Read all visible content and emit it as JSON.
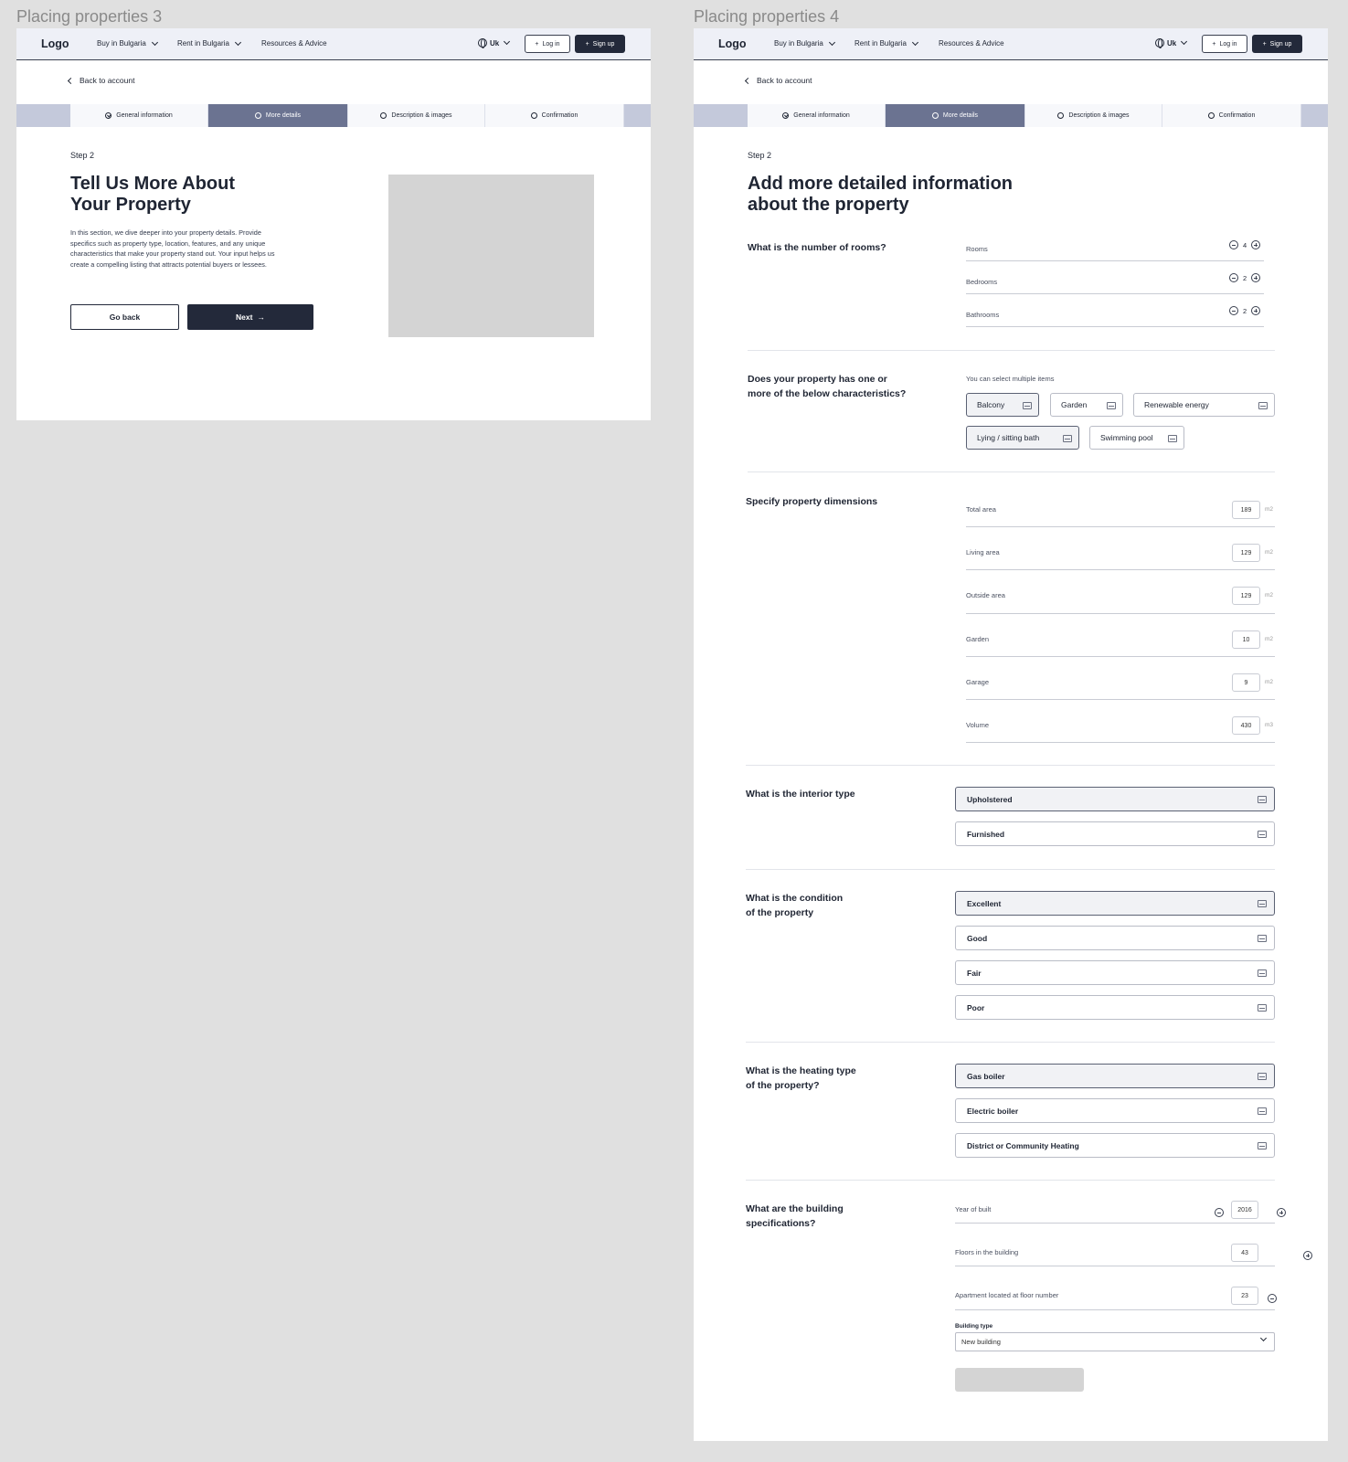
{
  "frames": {
    "left_label": "Placing properties 3",
    "right_label": "Placing properties 4"
  },
  "nav": {
    "logo": "Logo",
    "buy": "Buy in Bulgaria",
    "rent": "Rent in Bulgaria",
    "resources": "Resources & Advice",
    "lang": "Uk",
    "login": "Log in",
    "signup": "Sign up"
  },
  "back": "Back to account",
  "steps": [
    "General information",
    "More details",
    "Description & images",
    "Confirmation"
  ],
  "active_step": 1,
  "step_label": "Step 2",
  "intro": {
    "title_line1": "Tell Us More About",
    "title_line2": "Your Property",
    "para1": "In this section, we dive deeper into your property details. Provide",
    "para2": "specifics such as property type, location, features, and any unique",
    "para3": "characteristics that make your property stand out. Your input helps us",
    "para4": "create a compelling listing that attracts potential buyers or lessees.",
    "go_back": "Go back",
    "next": "Next"
  },
  "form": {
    "title_line1": "Add more detailed information",
    "title_line2": "about the property",
    "rooms_q": "What is the number of rooms?",
    "rooms": [
      {
        "label": "Rooms",
        "value": "4"
      },
      {
        "label": "Bedrooms",
        "value": "2"
      },
      {
        "label": "Bathrooms",
        "value": "2"
      }
    ],
    "char_q1": "Does your property has one or",
    "char_q2": "more of the below characteristics?",
    "char_hint": "You can select multiple items",
    "characteristics": [
      "Balcony",
      "Garden",
      "Renewable energy",
      "Lying / sitting bath",
      "Swimming pool"
    ],
    "characteristics_selected": [
      "Balcony",
      "Lying / sitting bath"
    ],
    "dim_q": "Specify property dimensions",
    "dimensions": [
      {
        "label": "Total area",
        "value": "189",
        "unit": "m2"
      },
      {
        "label": "Living area",
        "value": "129",
        "unit": "m2"
      },
      {
        "label": "Outside area",
        "value": "129",
        "unit": "m2"
      },
      {
        "label": "Garden",
        "value": "10",
        "unit": "m2"
      },
      {
        "label": "Garage",
        "value": "9",
        "unit": "m2"
      },
      {
        "label": "Volume",
        "value": "430",
        "unit": "m3"
      }
    ],
    "interior_q": "What is the interior type",
    "interior": [
      "Upholstered",
      "Furnished"
    ],
    "interior_selected": "Upholstered",
    "condition_q1": "What is the condition",
    "condition_q2": "of the property",
    "condition": [
      "Excellent",
      "Good",
      "Fair",
      "Poor"
    ],
    "condition_selected": "Excellent",
    "heating_q1": "What is the heating type",
    "heating_q2": "of the property?",
    "heating": [
      "Gas boiler",
      "Electric boiler",
      "District or Community Heating"
    ],
    "heating_selected": "Gas boiler",
    "building_q1": "What are the building",
    "building_q2": "specifications?",
    "building": [
      {
        "label": "Year of built",
        "value": "2016"
      },
      {
        "label": "Floors in the building",
        "value": "43"
      },
      {
        "label": "Apartment located at floor number",
        "value": "23"
      }
    ],
    "building_type_label": "Building type",
    "building_type_value": "New building"
  }
}
